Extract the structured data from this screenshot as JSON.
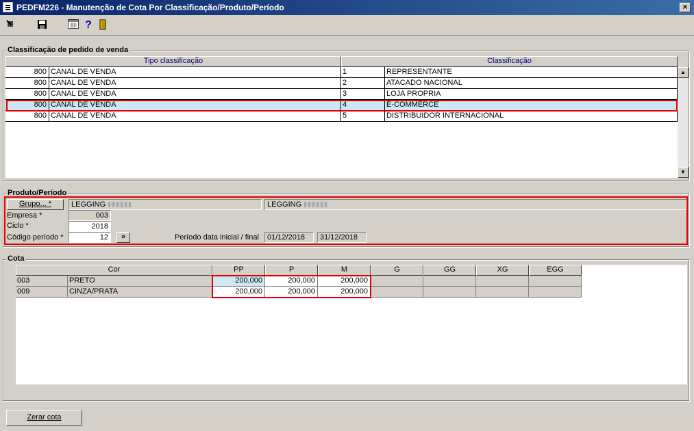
{
  "window": {
    "title": "PEDFM226 - Manutenção de Cota Por Classificação/Produto/Período",
    "close_glyph": "×"
  },
  "toolbar": {
    "icons": [
      "exit-icon",
      "save-icon",
      "calculator-icon",
      "help-icon",
      "door-icon"
    ],
    "help_glyph": "?"
  },
  "classification": {
    "group_title": "Classificação de pedido de venda",
    "columns": [
      "Tipo classificação",
      "Classificação"
    ],
    "rows": [
      {
        "tipo_code": "800",
        "tipo_desc": "CANAL DE VENDA",
        "class_code": "1",
        "class_desc": "REPRESENTANTE"
      },
      {
        "tipo_code": "800",
        "tipo_desc": "CANAL DE VENDA",
        "class_code": "2",
        "class_desc": "ATACADO NACIONAL"
      },
      {
        "tipo_code": "800",
        "tipo_desc": "CANAL DE VENDA",
        "class_code": "3",
        "class_desc": "LOJA PROPRIA"
      },
      {
        "tipo_code": "800",
        "tipo_desc": "CANAL DE VENDA",
        "class_code": "4",
        "class_desc": "E-COMMERCE"
      },
      {
        "tipo_code": "800",
        "tipo_desc": "CANAL DE VENDA",
        "class_code": "5",
        "class_desc": "DISTRIBUIDOR INTERNACIONAL"
      }
    ],
    "selected_index": 3
  },
  "produto": {
    "group_title": "Produto/Período",
    "grupo_button": "Grupo... *",
    "grupo_value": "LEGGING",
    "grupo_value_2": "LEGGING",
    "empresa_label": "Empresa *",
    "empresa_value": "003",
    "ciclo_label": "Ciclo *",
    "ciclo_value": "2018",
    "codigo_label": "Código período *",
    "codigo_value": "12",
    "next_button": "»",
    "periodo_label": "Período data inicial / final",
    "data_inicial": "01/12/2018",
    "data_final": "31/12/2018"
  },
  "cota": {
    "group_title": "Cota",
    "columns": [
      "Cor",
      "PP",
      "P",
      "M",
      "G",
      "GG",
      "XG",
      "EGG"
    ],
    "rows": [
      {
        "code": "003",
        "name": "PRETO",
        "values": [
          "200,000",
          "200,000",
          "200,000",
          "",
          "",
          "",
          ""
        ]
      },
      {
        "code": "009",
        "name": "CINZA/PRATA",
        "values": [
          "200,000",
          "200,000",
          "200,000",
          "",
          "",
          "",
          ""
        ]
      }
    ]
  },
  "footer": {
    "zerar_button": "Zerar cota"
  },
  "colors": {
    "selection": "#cce8f4",
    "highlight_border": "#e00000",
    "header_text": "#000080"
  }
}
